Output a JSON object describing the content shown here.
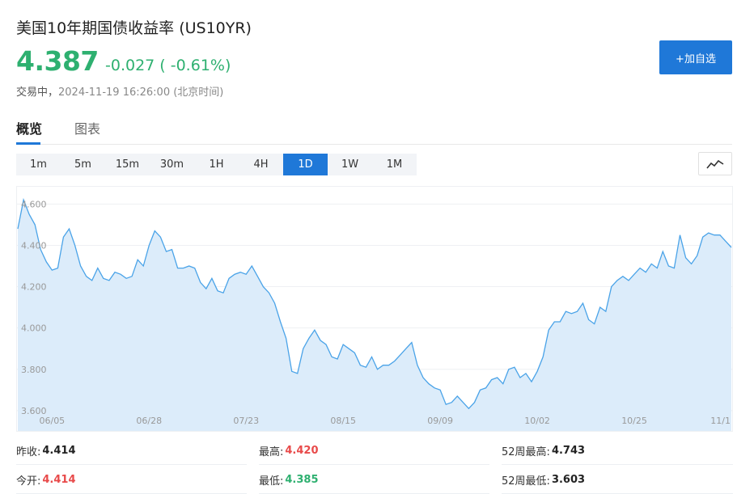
{
  "header": {
    "title": "美国10年期国债收益率",
    "code": "(US10YR)",
    "price": "4.387",
    "change": "-0.027 ( -0.61%)",
    "status": "交易中，",
    "timestamp": "2024-11-19 16:26:00 (北京时间)",
    "add_button": "+加自选"
  },
  "tabs": [
    {
      "label": "概览",
      "active": true
    },
    {
      "label": "图表",
      "active": false
    }
  ],
  "intervals": [
    {
      "label": "1m"
    },
    {
      "label": "5m"
    },
    {
      "label": "15m"
    },
    {
      "label": "30m"
    },
    {
      "label": "1H"
    },
    {
      "label": "4H"
    },
    {
      "label": "1D",
      "active": true
    },
    {
      "label": "1W"
    },
    {
      "label": "1M"
    }
  ],
  "chart_type_icon": "line-chart-icon",
  "colors": {
    "accent": "#1f78d8",
    "down": "#2eb070",
    "up": "#e84a4a",
    "line": "#4aa3e8",
    "fill": "#dcecfa"
  },
  "chart_data": {
    "type": "area",
    "ylim": [
      3.58,
      4.66
    ],
    "y_ticks": [
      "3.600",
      "3.800",
      "4.000",
      "4.200",
      "4.400",
      "4.600"
    ],
    "x_ticks": [
      {
        "label": "06/05",
        "index": 6
      },
      {
        "label": "06/28",
        "index": 23
      },
      {
        "label": "07/23",
        "index": 40
      },
      {
        "label": "08/15",
        "index": 57
      },
      {
        "label": "09/09",
        "index": 74
      },
      {
        "label": "10/02",
        "index": 91
      },
      {
        "label": "10/25",
        "index": 108
      },
      {
        "label": "11/1",
        "index": 125
      }
    ],
    "values": [
      4.48,
      4.62,
      4.55,
      4.5,
      4.38,
      4.32,
      4.28,
      4.29,
      4.44,
      4.48,
      4.4,
      4.3,
      4.25,
      4.23,
      4.29,
      4.24,
      4.23,
      4.27,
      4.26,
      4.24,
      4.25,
      4.33,
      4.3,
      4.4,
      4.47,
      4.44,
      4.37,
      4.38,
      4.29,
      4.29,
      4.3,
      4.29,
      4.22,
      4.19,
      4.24,
      4.18,
      4.17,
      4.24,
      4.26,
      4.27,
      4.26,
      4.3,
      4.25,
      4.2,
      4.17,
      4.12,
      4.03,
      3.95,
      3.79,
      3.78,
      3.9,
      3.95,
      3.99,
      3.94,
      3.92,
      3.86,
      3.85,
      3.92,
      3.9,
      3.88,
      3.82,
      3.81,
      3.86,
      3.8,
      3.82,
      3.82,
      3.84,
      3.87,
      3.9,
      3.93,
      3.82,
      3.76,
      3.73,
      3.71,
      3.7,
      3.63,
      3.64,
      3.67,
      3.64,
      3.61,
      3.64,
      3.7,
      3.71,
      3.75,
      3.76,
      3.73,
      3.8,
      3.81,
      3.76,
      3.78,
      3.74,
      3.79,
      3.86,
      3.99,
      4.03,
      4.03,
      4.08,
      4.07,
      4.08,
      4.12,
      4.04,
      4.02,
      4.1,
      4.08,
      4.2,
      4.23,
      4.25,
      4.23,
      4.26,
      4.29,
      4.27,
      4.31,
      4.29,
      4.37,
      4.3,
      4.29,
      4.45,
      4.34,
      4.31,
      4.35,
      4.44,
      4.46,
      4.45,
      4.45,
      4.42,
      4.39
    ]
  },
  "stats": [
    [
      {
        "label": "昨收:",
        "value": "4.414",
        "tone": "neutral"
      },
      {
        "label": "最高:",
        "value": "4.420",
        "tone": "up"
      },
      {
        "label": "52周最高:",
        "value": "4.743",
        "tone": "neutral"
      }
    ],
    [
      {
        "label": "今开:",
        "value": "4.414",
        "tone": "up"
      },
      {
        "label": "最低:",
        "value": "4.385",
        "tone": "down"
      },
      {
        "label": "52周最低:",
        "value": "3.603",
        "tone": "neutral"
      }
    ]
  ]
}
